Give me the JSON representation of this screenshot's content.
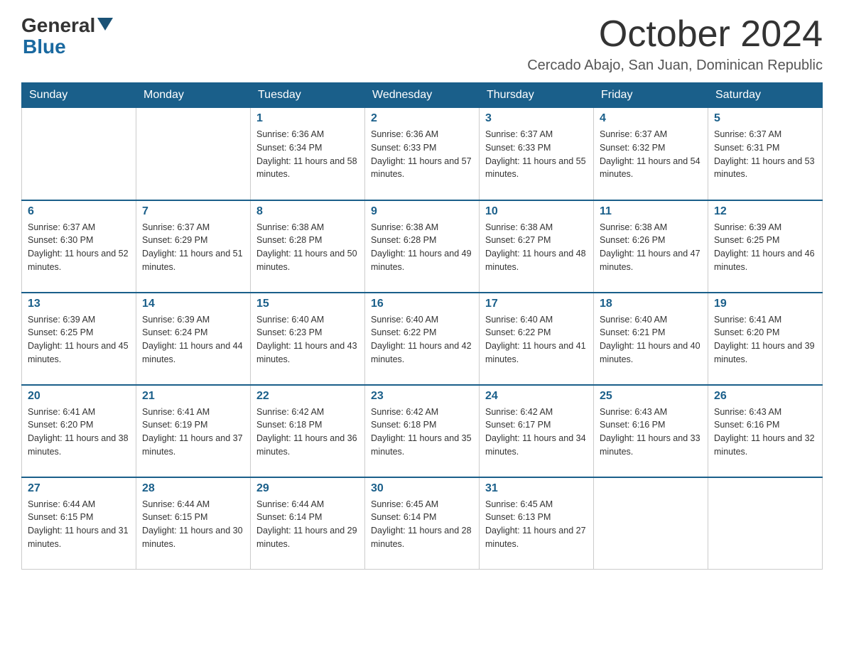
{
  "logo": {
    "general": "General",
    "blue": "Blue",
    "arrow": "▶"
  },
  "title": {
    "month_year": "October 2024",
    "location": "Cercado Abajo, San Juan, Dominican Republic"
  },
  "days_of_week": [
    "Sunday",
    "Monday",
    "Tuesday",
    "Wednesday",
    "Thursday",
    "Friday",
    "Saturday"
  ],
  "weeks": [
    [
      {
        "day": "",
        "sunrise": "",
        "sunset": "",
        "daylight": ""
      },
      {
        "day": "",
        "sunrise": "",
        "sunset": "",
        "daylight": ""
      },
      {
        "day": "1",
        "sunrise": "Sunrise: 6:36 AM",
        "sunset": "Sunset: 6:34 PM",
        "daylight": "Daylight: 11 hours and 58 minutes."
      },
      {
        "day": "2",
        "sunrise": "Sunrise: 6:36 AM",
        "sunset": "Sunset: 6:33 PM",
        "daylight": "Daylight: 11 hours and 57 minutes."
      },
      {
        "day": "3",
        "sunrise": "Sunrise: 6:37 AM",
        "sunset": "Sunset: 6:33 PM",
        "daylight": "Daylight: 11 hours and 55 minutes."
      },
      {
        "day": "4",
        "sunrise": "Sunrise: 6:37 AM",
        "sunset": "Sunset: 6:32 PM",
        "daylight": "Daylight: 11 hours and 54 minutes."
      },
      {
        "day": "5",
        "sunrise": "Sunrise: 6:37 AM",
        "sunset": "Sunset: 6:31 PM",
        "daylight": "Daylight: 11 hours and 53 minutes."
      }
    ],
    [
      {
        "day": "6",
        "sunrise": "Sunrise: 6:37 AM",
        "sunset": "Sunset: 6:30 PM",
        "daylight": "Daylight: 11 hours and 52 minutes."
      },
      {
        "day": "7",
        "sunrise": "Sunrise: 6:37 AM",
        "sunset": "Sunset: 6:29 PM",
        "daylight": "Daylight: 11 hours and 51 minutes."
      },
      {
        "day": "8",
        "sunrise": "Sunrise: 6:38 AM",
        "sunset": "Sunset: 6:28 PM",
        "daylight": "Daylight: 11 hours and 50 minutes."
      },
      {
        "day": "9",
        "sunrise": "Sunrise: 6:38 AM",
        "sunset": "Sunset: 6:28 PM",
        "daylight": "Daylight: 11 hours and 49 minutes."
      },
      {
        "day": "10",
        "sunrise": "Sunrise: 6:38 AM",
        "sunset": "Sunset: 6:27 PM",
        "daylight": "Daylight: 11 hours and 48 minutes."
      },
      {
        "day": "11",
        "sunrise": "Sunrise: 6:38 AM",
        "sunset": "Sunset: 6:26 PM",
        "daylight": "Daylight: 11 hours and 47 minutes."
      },
      {
        "day": "12",
        "sunrise": "Sunrise: 6:39 AM",
        "sunset": "Sunset: 6:25 PM",
        "daylight": "Daylight: 11 hours and 46 minutes."
      }
    ],
    [
      {
        "day": "13",
        "sunrise": "Sunrise: 6:39 AM",
        "sunset": "Sunset: 6:25 PM",
        "daylight": "Daylight: 11 hours and 45 minutes."
      },
      {
        "day": "14",
        "sunrise": "Sunrise: 6:39 AM",
        "sunset": "Sunset: 6:24 PM",
        "daylight": "Daylight: 11 hours and 44 minutes."
      },
      {
        "day": "15",
        "sunrise": "Sunrise: 6:40 AM",
        "sunset": "Sunset: 6:23 PM",
        "daylight": "Daylight: 11 hours and 43 minutes."
      },
      {
        "day": "16",
        "sunrise": "Sunrise: 6:40 AM",
        "sunset": "Sunset: 6:22 PM",
        "daylight": "Daylight: 11 hours and 42 minutes."
      },
      {
        "day": "17",
        "sunrise": "Sunrise: 6:40 AM",
        "sunset": "Sunset: 6:22 PM",
        "daylight": "Daylight: 11 hours and 41 minutes."
      },
      {
        "day": "18",
        "sunrise": "Sunrise: 6:40 AM",
        "sunset": "Sunset: 6:21 PM",
        "daylight": "Daylight: 11 hours and 40 minutes."
      },
      {
        "day": "19",
        "sunrise": "Sunrise: 6:41 AM",
        "sunset": "Sunset: 6:20 PM",
        "daylight": "Daylight: 11 hours and 39 minutes."
      }
    ],
    [
      {
        "day": "20",
        "sunrise": "Sunrise: 6:41 AM",
        "sunset": "Sunset: 6:20 PM",
        "daylight": "Daylight: 11 hours and 38 minutes."
      },
      {
        "day": "21",
        "sunrise": "Sunrise: 6:41 AM",
        "sunset": "Sunset: 6:19 PM",
        "daylight": "Daylight: 11 hours and 37 minutes."
      },
      {
        "day": "22",
        "sunrise": "Sunrise: 6:42 AM",
        "sunset": "Sunset: 6:18 PM",
        "daylight": "Daylight: 11 hours and 36 minutes."
      },
      {
        "day": "23",
        "sunrise": "Sunrise: 6:42 AM",
        "sunset": "Sunset: 6:18 PM",
        "daylight": "Daylight: 11 hours and 35 minutes."
      },
      {
        "day": "24",
        "sunrise": "Sunrise: 6:42 AM",
        "sunset": "Sunset: 6:17 PM",
        "daylight": "Daylight: 11 hours and 34 minutes."
      },
      {
        "day": "25",
        "sunrise": "Sunrise: 6:43 AM",
        "sunset": "Sunset: 6:16 PM",
        "daylight": "Daylight: 11 hours and 33 minutes."
      },
      {
        "day": "26",
        "sunrise": "Sunrise: 6:43 AM",
        "sunset": "Sunset: 6:16 PM",
        "daylight": "Daylight: 11 hours and 32 minutes."
      }
    ],
    [
      {
        "day": "27",
        "sunrise": "Sunrise: 6:44 AM",
        "sunset": "Sunset: 6:15 PM",
        "daylight": "Daylight: 11 hours and 31 minutes."
      },
      {
        "day": "28",
        "sunrise": "Sunrise: 6:44 AM",
        "sunset": "Sunset: 6:15 PM",
        "daylight": "Daylight: 11 hours and 30 minutes."
      },
      {
        "day": "29",
        "sunrise": "Sunrise: 6:44 AM",
        "sunset": "Sunset: 6:14 PM",
        "daylight": "Daylight: 11 hours and 29 minutes."
      },
      {
        "day": "30",
        "sunrise": "Sunrise: 6:45 AM",
        "sunset": "Sunset: 6:14 PM",
        "daylight": "Daylight: 11 hours and 28 minutes."
      },
      {
        "day": "31",
        "sunrise": "Sunrise: 6:45 AM",
        "sunset": "Sunset: 6:13 PM",
        "daylight": "Daylight: 11 hours and 27 minutes."
      },
      {
        "day": "",
        "sunrise": "",
        "sunset": "",
        "daylight": ""
      },
      {
        "day": "",
        "sunrise": "",
        "sunset": "",
        "daylight": ""
      }
    ]
  ]
}
